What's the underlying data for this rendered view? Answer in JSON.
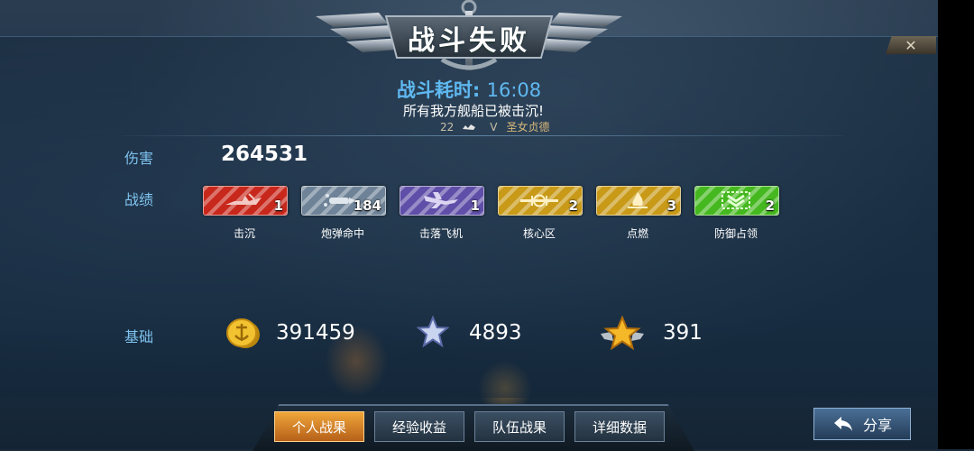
{
  "header": {
    "title": "战斗失败",
    "close_icon": "close-icon"
  },
  "battle": {
    "duration_label": "战斗耗时:",
    "duration_value": "16:08",
    "message": "所有我方舰船已被击沉!",
    "ship_level": "22",
    "ship_rank": "V",
    "ship_name": "圣女贞德"
  },
  "damage": {
    "label": "伤害",
    "value": "264531"
  },
  "record": {
    "label": "战绩",
    "badges": [
      {
        "label": "击沉",
        "count": "1",
        "color": "#c8281c",
        "icon": "sunk-ship-icon"
      },
      {
        "label": "炮弹命中",
        "count": "184",
        "color": "#6e8397",
        "icon": "shell-hit-icon"
      },
      {
        "label": "击落飞机",
        "count": "1",
        "color": "#5f4fa8",
        "icon": "plane-shot-icon"
      },
      {
        "label": "核心区",
        "count": "2",
        "color": "#c89a18",
        "icon": "core-area-icon"
      },
      {
        "label": "点燃",
        "count": "3",
        "color": "#c89a18",
        "icon": "fire-icon"
      },
      {
        "label": "防御占领",
        "count": "2",
        "color": "#45b81f",
        "icon": "defend-capture-icon"
      }
    ]
  },
  "base": {
    "label": "基础",
    "gold_icon": "gold-coin-icon",
    "gold": "391459",
    "exp_icon": "silver-star-icon",
    "exp": "4893",
    "rank_icon": "gold-star-wings-icon",
    "rank": "391"
  },
  "tabs": [
    {
      "label": "个人战果",
      "active": true
    },
    {
      "label": "经验收益",
      "active": false
    },
    {
      "label": "队伍战果",
      "active": false
    },
    {
      "label": "详细数据",
      "active": false
    }
  ],
  "share": {
    "label": "分享",
    "icon": "share-arrow-icon"
  }
}
